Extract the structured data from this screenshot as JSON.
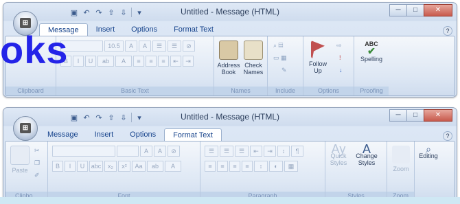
{
  "window_top": {
    "title": "Untitled - Message (HTML)",
    "tabs": [
      "Message",
      "Insert",
      "Options",
      "Format Text"
    ],
    "active_tab": "Message",
    "font_size": "10.5",
    "groups": {
      "clipboard": "Clipboard",
      "basic_text": "Basic Text",
      "names": "Names",
      "include": "Include",
      "options": "Options",
      "proofing": "Proofing"
    },
    "buttons": {
      "address_book": [
        "Address",
        "Book"
      ],
      "check_names": [
        "Check",
        "Names"
      ],
      "follow_up": [
        "Follow",
        "Up"
      ],
      "spelling": "Spelling"
    },
    "overlay_text": "oks"
  },
  "window_bottom": {
    "title": "Untitled - Message (HTML)",
    "tabs": [
      "Message",
      "Insert",
      "Options",
      "Format Text"
    ],
    "active_tab": "Format Text",
    "groups": {
      "clipboard": "Clipbo...",
      "font": "Font",
      "paragraph": "Paragraph",
      "styles": "Styles",
      "zoom": "Zoom"
    },
    "buttons": {
      "paste": "Paste",
      "quick_styles": [
        "Quick",
        "Styles"
      ],
      "change_styles": [
        "Change",
        "Styles"
      ],
      "zoom": "Zoom",
      "editing": "Editing"
    }
  }
}
